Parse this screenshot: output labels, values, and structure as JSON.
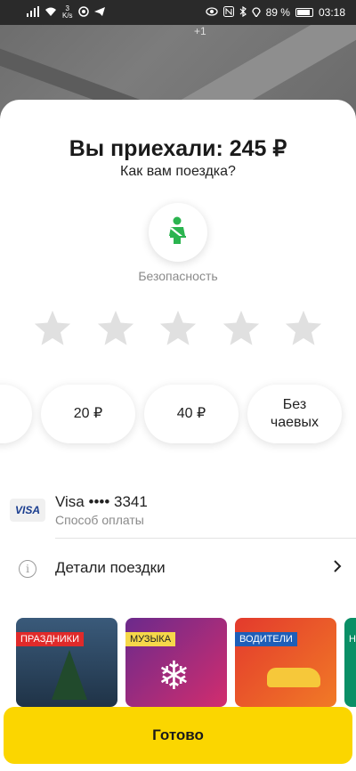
{
  "status_bar": {
    "speed_value": "3",
    "speed_unit": "K/s",
    "battery_percent": "89 %",
    "time": "03:18",
    "battery_level": 0.89
  },
  "map": {
    "badge": "+1"
  },
  "trip": {
    "title": "Вы приехали: 245 ₽",
    "subtitle": "Как вам поездка?"
  },
  "safety": {
    "label": "Безопасность",
    "icon": "seatbelt-icon",
    "accent": "#2bb44f"
  },
  "rating": {
    "max": 5,
    "selected": 0
  },
  "tips": [
    {
      "label": ""
    },
    {
      "label": "20 ₽"
    },
    {
      "label": "40 ₽"
    },
    {
      "label": "Без чаевых"
    }
  ],
  "payment": {
    "card_brand": "VISA",
    "title": "Visa •••• 3341",
    "subtitle": "Способ оплаты"
  },
  "details": {
    "label": "Детали поездки"
  },
  "stories": [
    {
      "tag": "ПРАЗДНИКИ"
    },
    {
      "tag": "МУЗЫКА"
    },
    {
      "tag": "ВОДИТЕЛИ"
    },
    {
      "tag": "Н"
    }
  ],
  "done_button": {
    "label": "Готово",
    "color": "#fbd600"
  }
}
